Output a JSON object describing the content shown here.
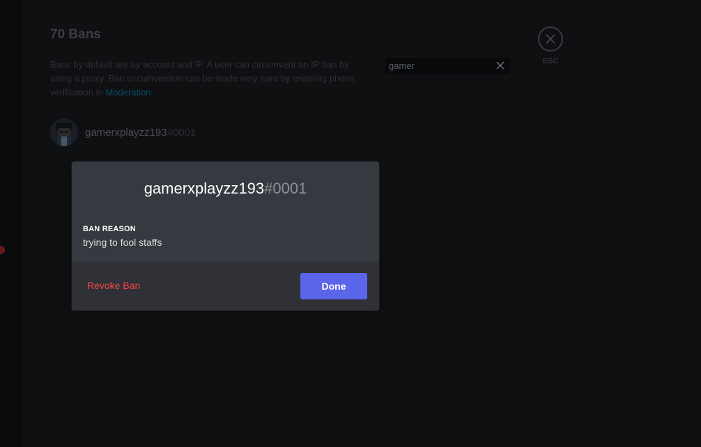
{
  "page": {
    "title": "70 Bans",
    "description": "Bans by default are by account and IP. A user can circumvent an IP ban by using a proxy. Ban circumvention can be made very hard by enabling phone verification in ",
    "description_link": "Moderation",
    "description_end": "."
  },
  "search": {
    "value": "gamer",
    "clear_icon": "close-icon"
  },
  "esc": {
    "label": "ESC",
    "icon": "close-icon"
  },
  "ban_list": [
    {
      "username": "gamerxplayzz193",
      "discriminator": "#0001"
    }
  ],
  "modal": {
    "username": "gamerxplayzz193",
    "discriminator": "#0001",
    "reason_title": "BAN REASON",
    "reason_text": "trying to fool staffs",
    "revoke_label": "Revoke Ban",
    "done_label": "Done"
  },
  "colors": {
    "modal_bg": "#36393f",
    "footer_bg": "#2f3136",
    "danger": "#f04747",
    "brand": "#5b65ea",
    "link": "#00b0f4"
  }
}
